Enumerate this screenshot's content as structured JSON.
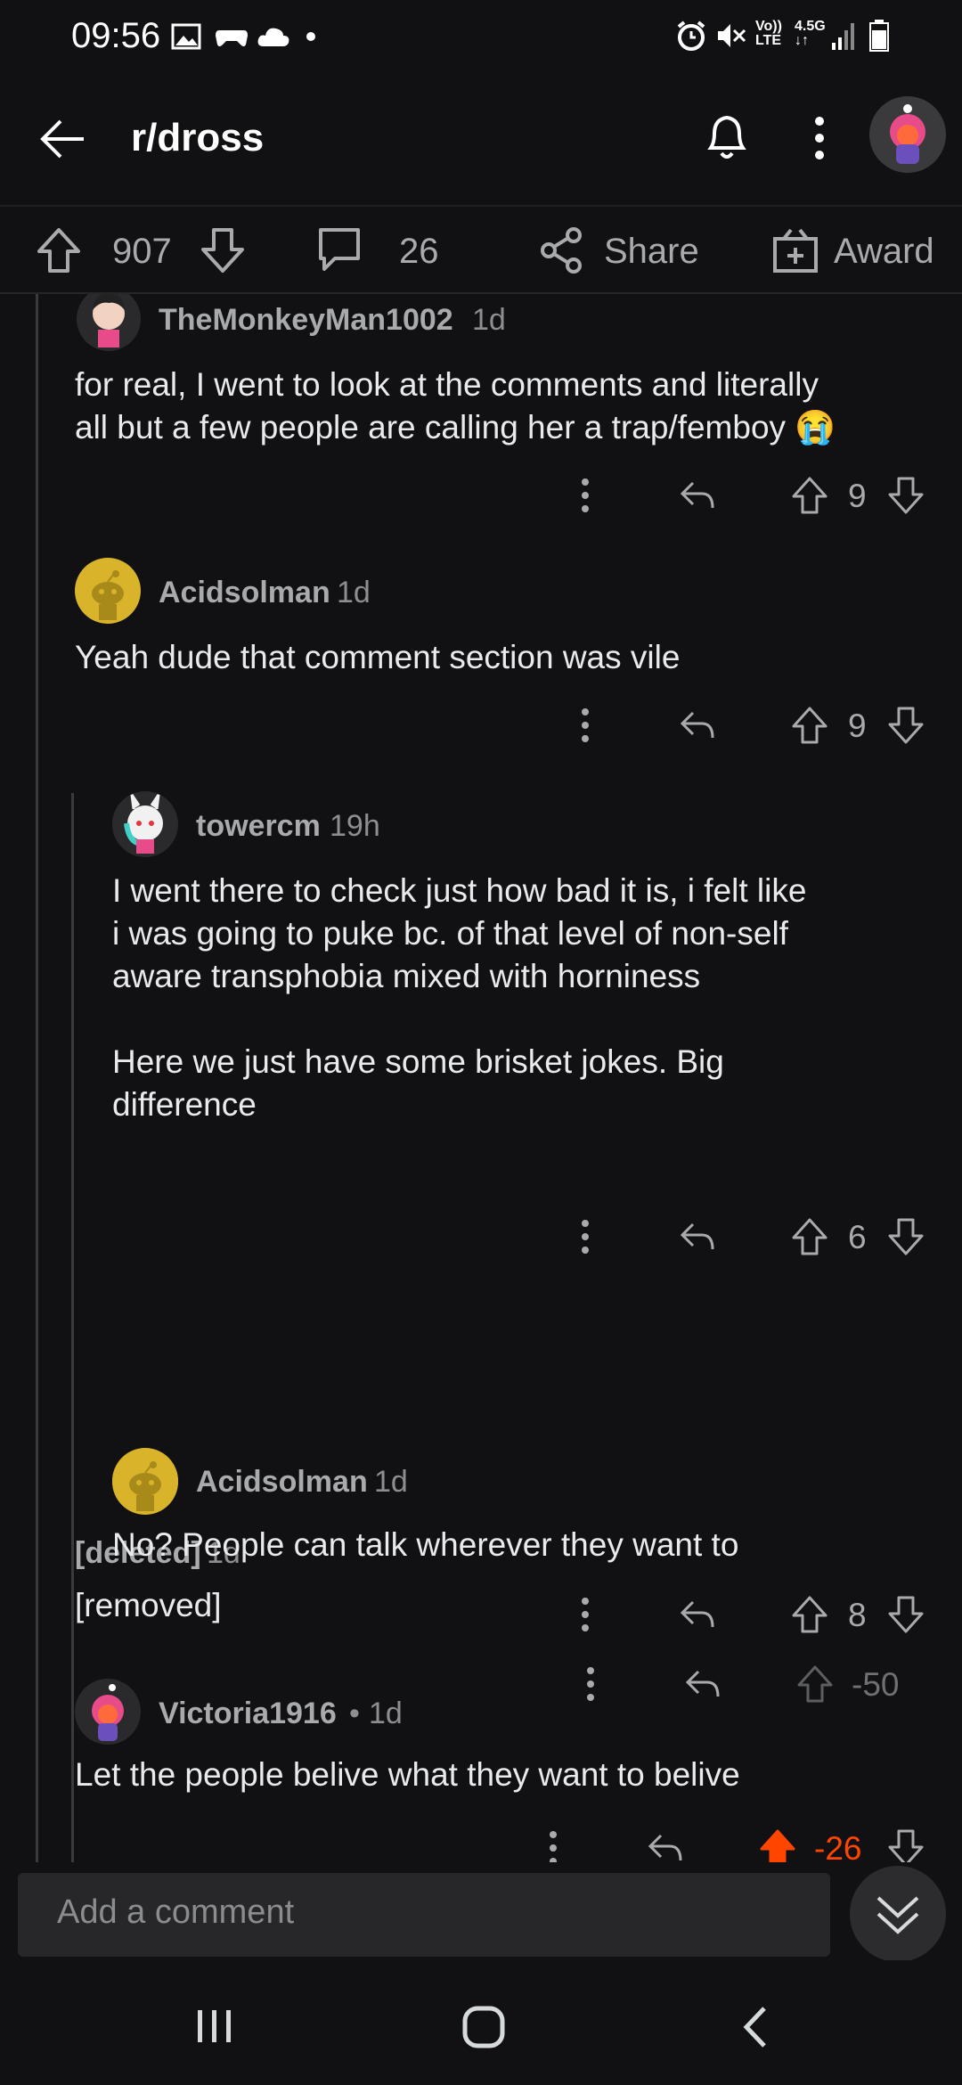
{
  "status_bar": {
    "time": "09:56",
    "network": "4.5G",
    "lte": "LTE",
    "volte": "Vo))"
  },
  "header": {
    "subreddit": "r/dross"
  },
  "post_actions": {
    "score": "907",
    "comments": "26",
    "share_label": "Share",
    "award_label": "Award"
  },
  "comments": [
    {
      "username": "TheMonkeyMan1002",
      "age": "1d",
      "body": [
        "for real, I went to look at the comments and literally",
        "all but a few people are calling her a trap/femboy 😭"
      ],
      "score": "9"
    },
    {
      "username": "Acidsolman",
      "age": "1d",
      "body": [
        "Yeah dude that comment section was vile"
      ],
      "score": "9"
    },
    {
      "username": "towercm",
      "age": "19h",
      "body": [
        "I went there to check just how bad it is, i felt like",
        "i was going to puke bc. of that level of non-self",
        "aware transphobia mixed with horniness",
        "",
        "Here we just have some brisket jokes. Big",
        "difference"
      ],
      "score": "6"
    },
    {
      "username": "[deleted]",
      "age": "1d",
      "body": [
        "[removed]"
      ],
      "score": "-50"
    },
    {
      "username": "Acidsolman",
      "age": "1d",
      "body": [
        "No? People can talk wherever they want to"
      ],
      "score": "8"
    },
    {
      "username": "Victoria1916",
      "separator": "•",
      "age": "1d",
      "body": [
        "Let the people belive what they want to belive"
      ],
      "score": "-26"
    }
  ],
  "composer": {
    "placeholder": "Add a comment"
  },
  "colors": {
    "background": "#111113",
    "upvote_orange": "#ff4500",
    "snoo_yellow": "#d9b42a",
    "text": "#e8eaeb",
    "muted": "#a8aaab"
  }
}
